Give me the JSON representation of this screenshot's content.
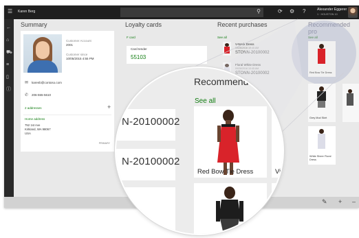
{
  "topbar": {
    "user_name": "Karen Berg",
    "signed_in_user": "Alexander Eggerer",
    "store_info": "1 · HOUSTON 10"
  },
  "sections": {
    "summary": "Summary",
    "loyalty": "Loyalty cards",
    "recent": "Recent purchases",
    "recommended_partial": "Recommended pro"
  },
  "summary": {
    "customer_account_label": "Customer Account",
    "customer_account_value": "2001",
    "customer_since_label": "Customer since",
    "customer_since_value": "10/05/2015 4:55 PM",
    "email": "karenb@contoso.com",
    "phone": "206-555-5610",
    "addresses_link": "2 addresses",
    "home_address_label": "Home address",
    "address_line1": "752 1st Ave",
    "address_line2": "Kirkland, WA 98067",
    "address_line3": "USA",
    "primary_badge": "PRIMARY"
  },
  "loyalty": {
    "card_label": "F card",
    "card_tender": "Card tender",
    "card_number": "55103"
  },
  "recent_purchases": [
    {
      "name": "V-Neck Dress",
      "date": "09/26/2016 10:45 AM",
      "order": "STONN-20100002"
    },
    {
      "name": "Floral White Dress",
      "date": "09/26/2016 10:45 AM",
      "order": "STONN-20100002"
    }
  ],
  "recent_see_all": "See all",
  "recommended_small": {
    "see_all": "See all",
    "items": [
      "Red Bow Tie Dress",
      "Grey Mod Skirt",
      "White Sheer Floral Dress"
    ]
  },
  "magnifier": {
    "title": "Recommended",
    "see_all": "See all",
    "order_1": "N-20100002",
    "order_2": "N-20100002",
    "product_1": "Red Bow Tie Dress",
    "product_2_partial": "Viole"
  },
  "icons": [
    "hamburger-icon",
    "back-icon",
    "home-icon",
    "search-icon",
    "refresh-icon",
    "settings-icon",
    "help-icon",
    "edit-icon",
    "add-icon"
  ],
  "colors": {
    "accent_green": "#107c10",
    "topbar": "#1f1f1f",
    "red_dress": "#d9232a"
  }
}
